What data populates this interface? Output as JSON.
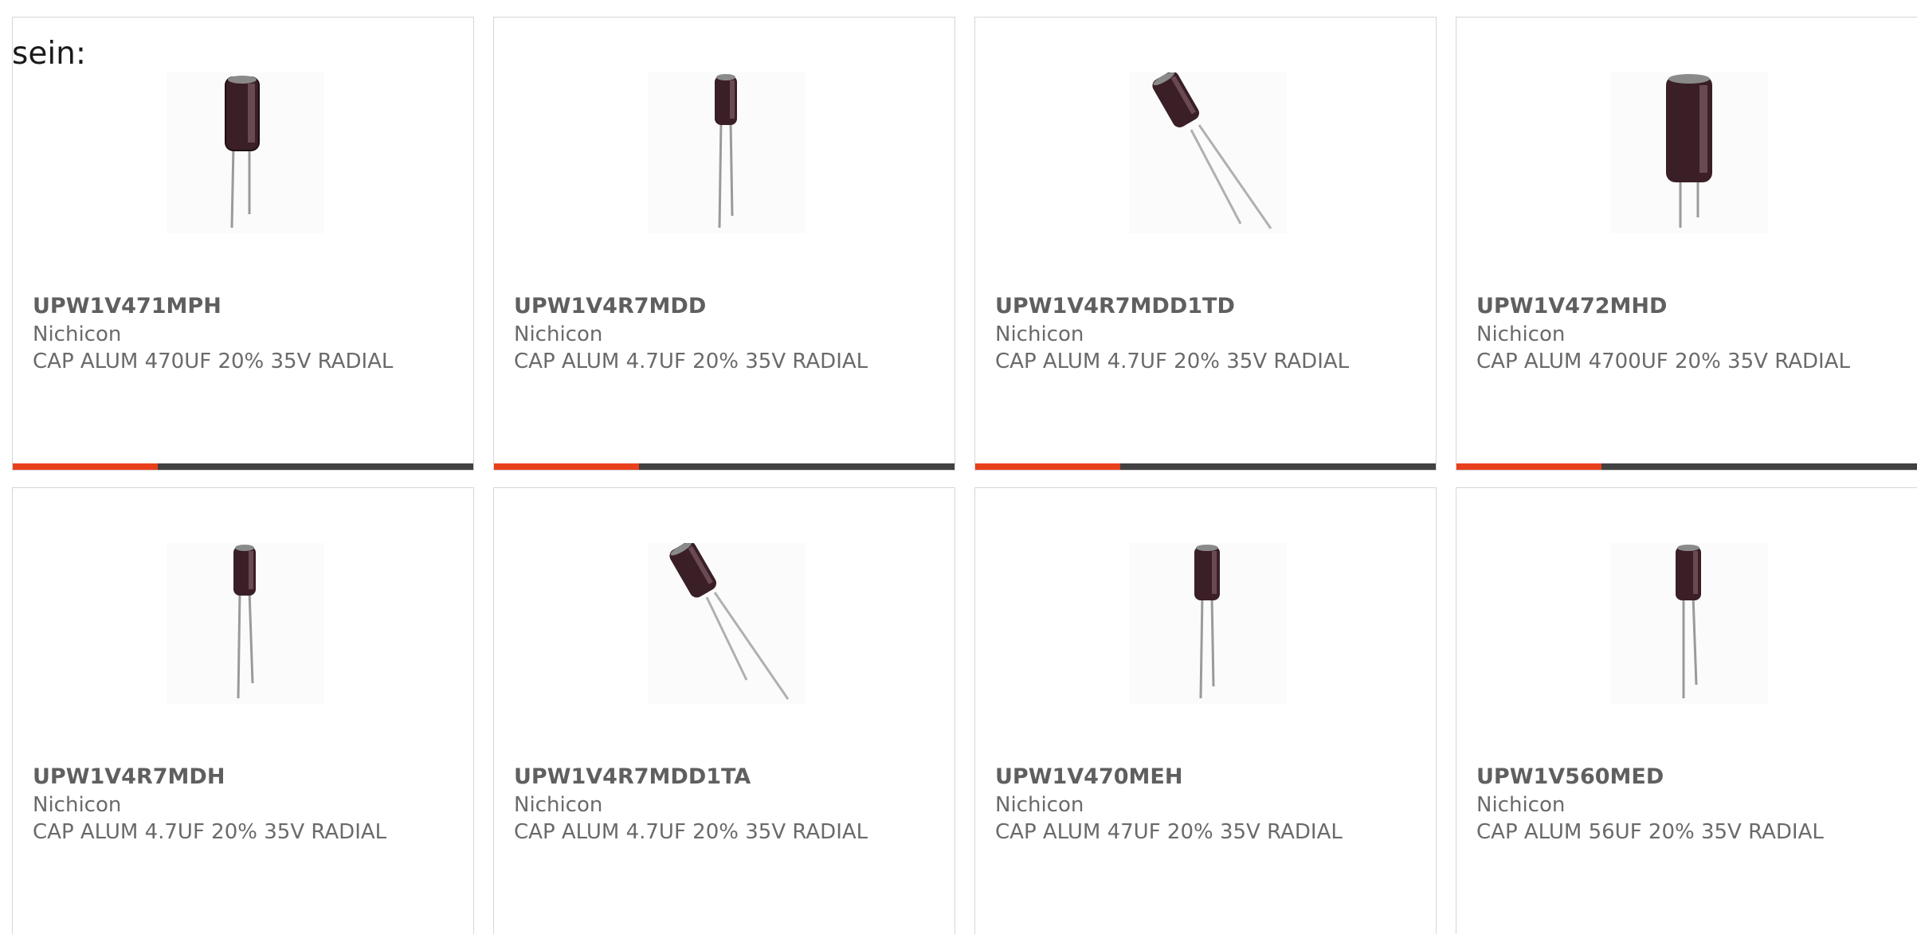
{
  "intro_text": "sein:",
  "products": [
    {
      "part": "UPW1V471MPH",
      "maker": "Nichicon",
      "desc": "CAP ALUM 470UF 20% 35V RADIAL",
      "image": "capacitor-upright"
    },
    {
      "part": "UPW1V4R7MDD",
      "maker": "Nichicon",
      "desc": "CAP ALUM 4.7UF 20% 35V RADIAL",
      "image": "capacitor-slim"
    },
    {
      "part": "UPW1V4R7MDD1TD",
      "maker": "Nichicon",
      "desc": "CAP ALUM 4.7UF 20% 35V RADIAL",
      "image": "capacitor-tilted"
    },
    {
      "part": "UPW1V472MHD",
      "maker": "Nichicon",
      "desc": "CAP ALUM 4700UF 20% 35V RADIAL",
      "image": "capacitor-large"
    },
    {
      "part": "UPW1V4R7MDH",
      "maker": "Nichicon",
      "desc": "CAP ALUM 4.7UF 20% 35V RADIAL",
      "image": "capacitor-slim"
    },
    {
      "part": "UPW1V4R7MDD1TA",
      "maker": "Nichicon",
      "desc": "CAP ALUM 4.7UF 20% 35V RADIAL",
      "image": "capacitor-tilted"
    },
    {
      "part": "UPW1V470MEH",
      "maker": "Nichicon",
      "desc": "CAP ALUM 47UF 20% 35V RADIAL",
      "image": "capacitor-upright"
    },
    {
      "part": "UPW1V560MED",
      "maker": "Nichicon",
      "desc": "CAP ALUM 56UF 20% 35V RADIAL",
      "image": "capacitor-upright"
    }
  ],
  "colors": {
    "accent": "#e8401c",
    "bar": "#414141",
    "text": "#666666",
    "capacitor_body": "#3a1f26"
  }
}
